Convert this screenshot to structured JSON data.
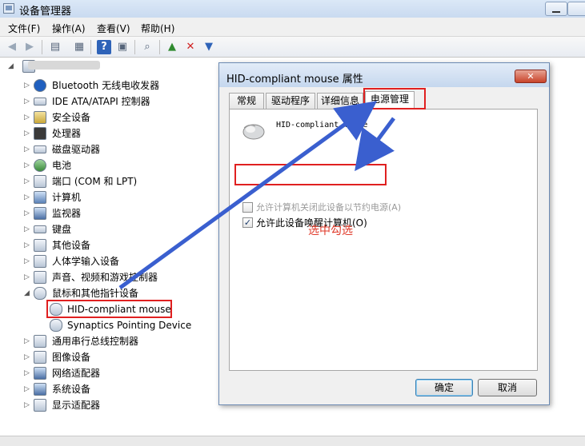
{
  "window": {
    "title": "设备管理器"
  },
  "menu": {
    "items": [
      "文件(F)",
      "操作(A)",
      "查看(V)",
      "帮助(H)"
    ]
  },
  "toolbar": {
    "buttons": [
      "back-icon",
      "forward-icon",
      "properties-sheet-icon",
      "show-hidden-icon",
      "help-icon",
      "view-icon",
      "scan-hardware-icon",
      "update-driver-icon",
      "uninstall-icon",
      "enable-device-icon"
    ]
  },
  "tree": {
    "categories": [
      "Bluetooth 无线电收发器",
      "IDE ATA/ATAPI 控制器",
      "安全设备",
      "处理器",
      "磁盘驱动器",
      "电池",
      "端口 (COM 和 LPT)",
      "计算机",
      "监视器",
      "键盘",
      "其他设备",
      "人体学输入设备",
      "声音、视频和游戏控制器",
      "鼠标和其他指针设备",
      "HID-compliant mouse",
      "Synaptics Pointing Device",
      "通用串行总线控制器",
      "图像设备",
      "网络适配器",
      "系统设备",
      "显示适配器"
    ]
  },
  "dialog": {
    "title": "HID-compliant mouse 属性",
    "close_label": "✕",
    "tabs": [
      "常规",
      "驱动程序",
      "详细信息",
      "电源管理"
    ],
    "active_tab": "电源管理",
    "device_name": "HID-compliant mouse",
    "options": [
      {
        "label": "允许计算机关闭此设备以节约电源(A)",
        "checked": false,
        "enabled": false
      },
      {
        "label": "允许此设备唤醒计算机(O)",
        "checked": true,
        "enabled": true
      }
    ],
    "ok_label": "确定",
    "cancel_label": "取消"
  },
  "annotation": {
    "text": "选中勾选",
    "color": "#e03a2a"
  },
  "colors": {
    "highlight_red": "#e02020",
    "arrow_blue": "#3a5fcf"
  }
}
